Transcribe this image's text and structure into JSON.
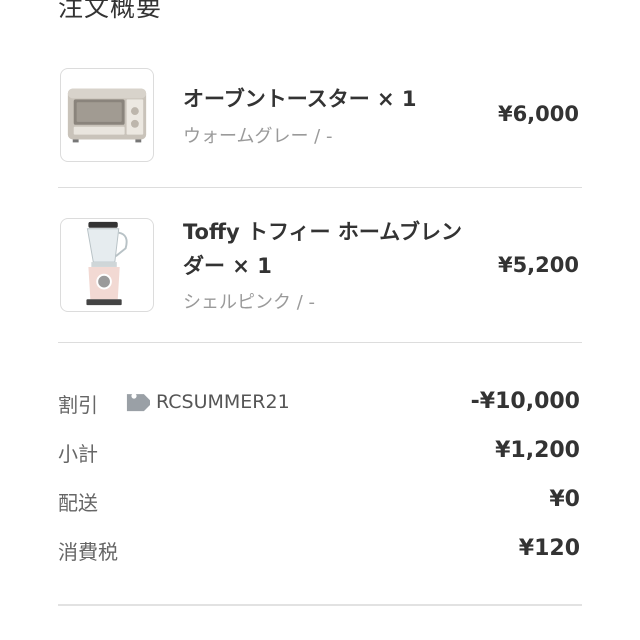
{
  "section_title": "注文概要",
  "items": [
    {
      "name": "オーブントースター × 1",
      "variant": "ウォームグレー / -",
      "price": "¥6,000",
      "thumbnail_icon": "oven-toaster-image"
    },
    {
      "name": "Toffy トフィー ホームブレンダー × 1",
      "variant": "シェルピンク / -",
      "price": "¥5,200",
      "thumbnail_icon": "blender-image"
    }
  ],
  "summary": {
    "discount": {
      "label": "割引",
      "code": "RCSUMMER21",
      "value": "-¥10,000",
      "icon": "tag-icon"
    },
    "subtotal": {
      "label": "小計",
      "value": "¥1,200"
    },
    "shipping": {
      "label": "配送",
      "value": "¥0"
    },
    "tax": {
      "label": "消費税",
      "value": "¥120"
    }
  },
  "colors": {
    "text_primary": "#333333",
    "text_secondary": "#9a9a9a",
    "divider": "#dddddd",
    "tag_icon": "#9aa0a6"
  }
}
